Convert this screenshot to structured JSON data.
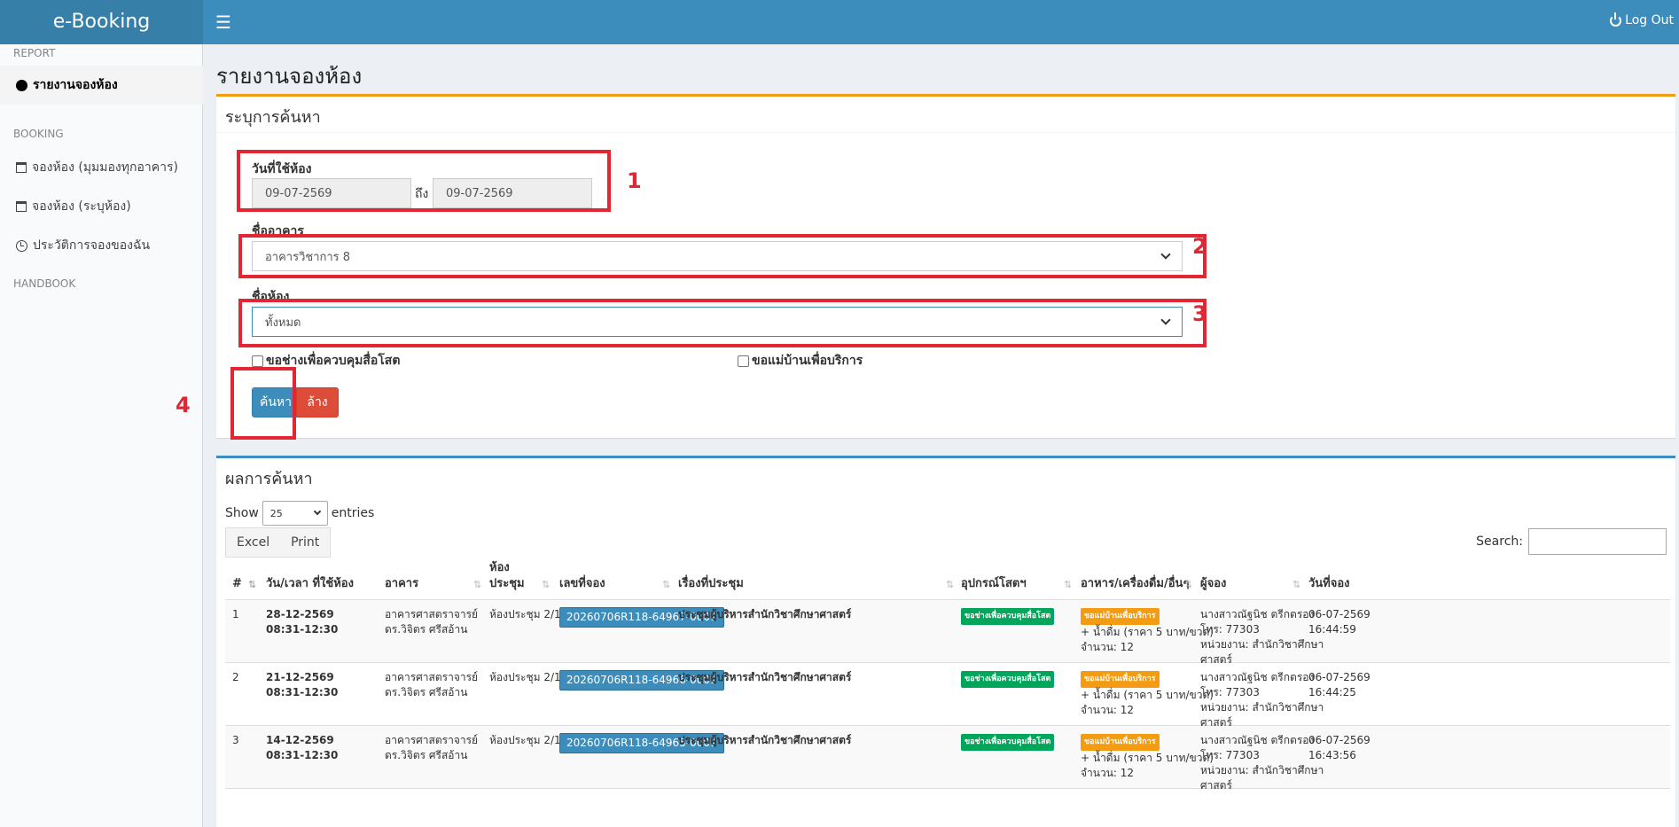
{
  "app": {
    "brand": "e-Booking",
    "menu_icon": "hamburger-icon",
    "logout_label": "Log Out"
  },
  "sidebar": {
    "report_header": "REPORT",
    "booking_header": "BOOKING",
    "handbook_header": "HANDBOOK",
    "items": [
      {
        "label": "รายงานจองห้อง",
        "icon": "dot-icon"
      },
      {
        "label": "จองห้อง (มุมมองทุกอาคาร)",
        "icon": "calendar-icon"
      },
      {
        "label": "จองห้อง (ระบุห้อง)",
        "icon": "calendar-icon"
      },
      {
        "label": "ประวัติการจองของฉัน",
        "icon": "clock-icon"
      }
    ]
  },
  "page": {
    "title": "รายงานจองห้อง"
  },
  "search_box": {
    "title": "ระบุการค้นหา",
    "date_label": "วันที่ใช้ห้อง",
    "date_from": "09-07-2569",
    "date_to_label": "ถึง",
    "date_to": "09-07-2569",
    "building_label": "ชื่ออาคาร",
    "building_value": "อาคารวิชาการ 8",
    "room_label": "ชื่อห้อง",
    "room_value": "ทั้งหมด",
    "checkbox_av": "ขอช่างเพื่อควบคุมสื่อโสต",
    "checkbox_housekeeper": "ขอแม่บ้านเพื่อบริการ",
    "search_button": "ค้นหา",
    "clear_button": "ล้าง"
  },
  "annotations": [
    "1",
    "2",
    "3",
    "4"
  ],
  "results": {
    "title": "ผลการค้นหา",
    "show_label": "Show",
    "page_size": "25",
    "entries_label": "entries",
    "excel_button": "Excel",
    "print_button": "Print",
    "search_label": "Search:",
    "columns": [
      "#",
      "วัน/เวลา ที่ใช้ห้อง",
      "อาคาร",
      "ห้องประชุม",
      "เลขที่จอง",
      "เรื่องที่ประชุม",
      "อุปกรณ์โสตฯ",
      "อาหาร/เครื่องดื่ม/อื่นๆ",
      "ผู้จอง",
      "วันที่จอง"
    ],
    "rows": [
      {
        "num": "1",
        "date": "28-12-2569",
        "time": "08:31-12:30",
        "building_1": "อาคารศาสตราจารย์",
        "building_2": "ดร.วิจิตร ศรีสอ้าน",
        "room": "ห้องประชุม 2/1",
        "booking_id": "20260706R118-64967-0001",
        "subject": "ประชุมผู้บริหารสำนักวิชาศึกษาศาสตร์",
        "av_badge": "ขอช่างเพื่อควบคุมสื่อโสต",
        "food_badge": "ขอแม่บ้านเพื่อบริการ",
        "food_item": "+ น้ำดื่ม (ราคา 5 บาท/ขวด)",
        "food_qty": "จำนวน: 12",
        "booker_name": "นางสาวณัฐนิช ตรีกตรอง",
        "booker_tel": "โทร: 77303",
        "booker_unit_1": "หน่วยงาน: สำนักวิชาศึกษา",
        "booker_unit_2": "ศาสตร์",
        "booked_date": "06-07-2569",
        "booked_time": "16:44:59"
      },
      {
        "num": "2",
        "date": "21-12-2569",
        "time": "08:31-12:30",
        "building_1": "อาคารศาสตราจารย์",
        "building_2": "ดร.วิจิตร ศรีสอ้าน",
        "room": "ห้องประชุม 2/1",
        "booking_id": "20260706R118-64966-0001",
        "subject": "ประชุมผู้บริหารสำนักวิชาศึกษาศาสตร์",
        "av_badge": "ขอช่างเพื่อควบคุมสื่อโสต",
        "food_badge": "ขอแม่บ้านเพื่อบริการ",
        "food_item": "+ น้ำดื่ม (ราคา 5 บาท/ขวด)",
        "food_qty": "จำนวน: 12",
        "booker_name": "นางสาวณัฐนิช ตรีกตรอง",
        "booker_tel": "โทร: 77303",
        "booker_unit_1": "หน่วยงาน: สำนักวิชาศึกษา",
        "booker_unit_2": "ศาสตร์",
        "booked_date": "06-07-2569",
        "booked_time": "16:44:25"
      },
      {
        "num": "3",
        "date": "14-12-2569",
        "time": "08:31-12:30",
        "building_1": "อาคารศาสตราจารย์",
        "building_2": "ดร.วิจิตร ศรีสอ้าน",
        "room": "ห้องประชุม 2/1",
        "booking_id": "20260706R118-64965-0001",
        "subject": "ประชุมผู้บริหารสำนักวิชาศึกษาศาสตร์",
        "av_badge": "ขอช่างเพื่อควบคุมสื่อโสต",
        "food_badge": "ขอแม่บ้านเพื่อบริการ",
        "food_item": "+ น้ำดื่ม (ราคา 5 บาท/ขวด)",
        "food_qty": "จำนวน: 12",
        "booker_name": "นางสาวณัฐนิช ตรีกตรอง",
        "booker_tel": "โทร: 77303",
        "booker_unit_1": "หน่วยงาน: สำนักวิชาศึกษา",
        "booker_unit_2": "ศาสตร์",
        "booked_date": "06-07-2569",
        "booked_time": "16:43:56"
      }
    ]
  },
  "colors": {
    "header": "#3c8dbc",
    "brand_bg": "#367fa9",
    "annotation_red": "#e32631",
    "warning_border": "#f39c12"
  }
}
